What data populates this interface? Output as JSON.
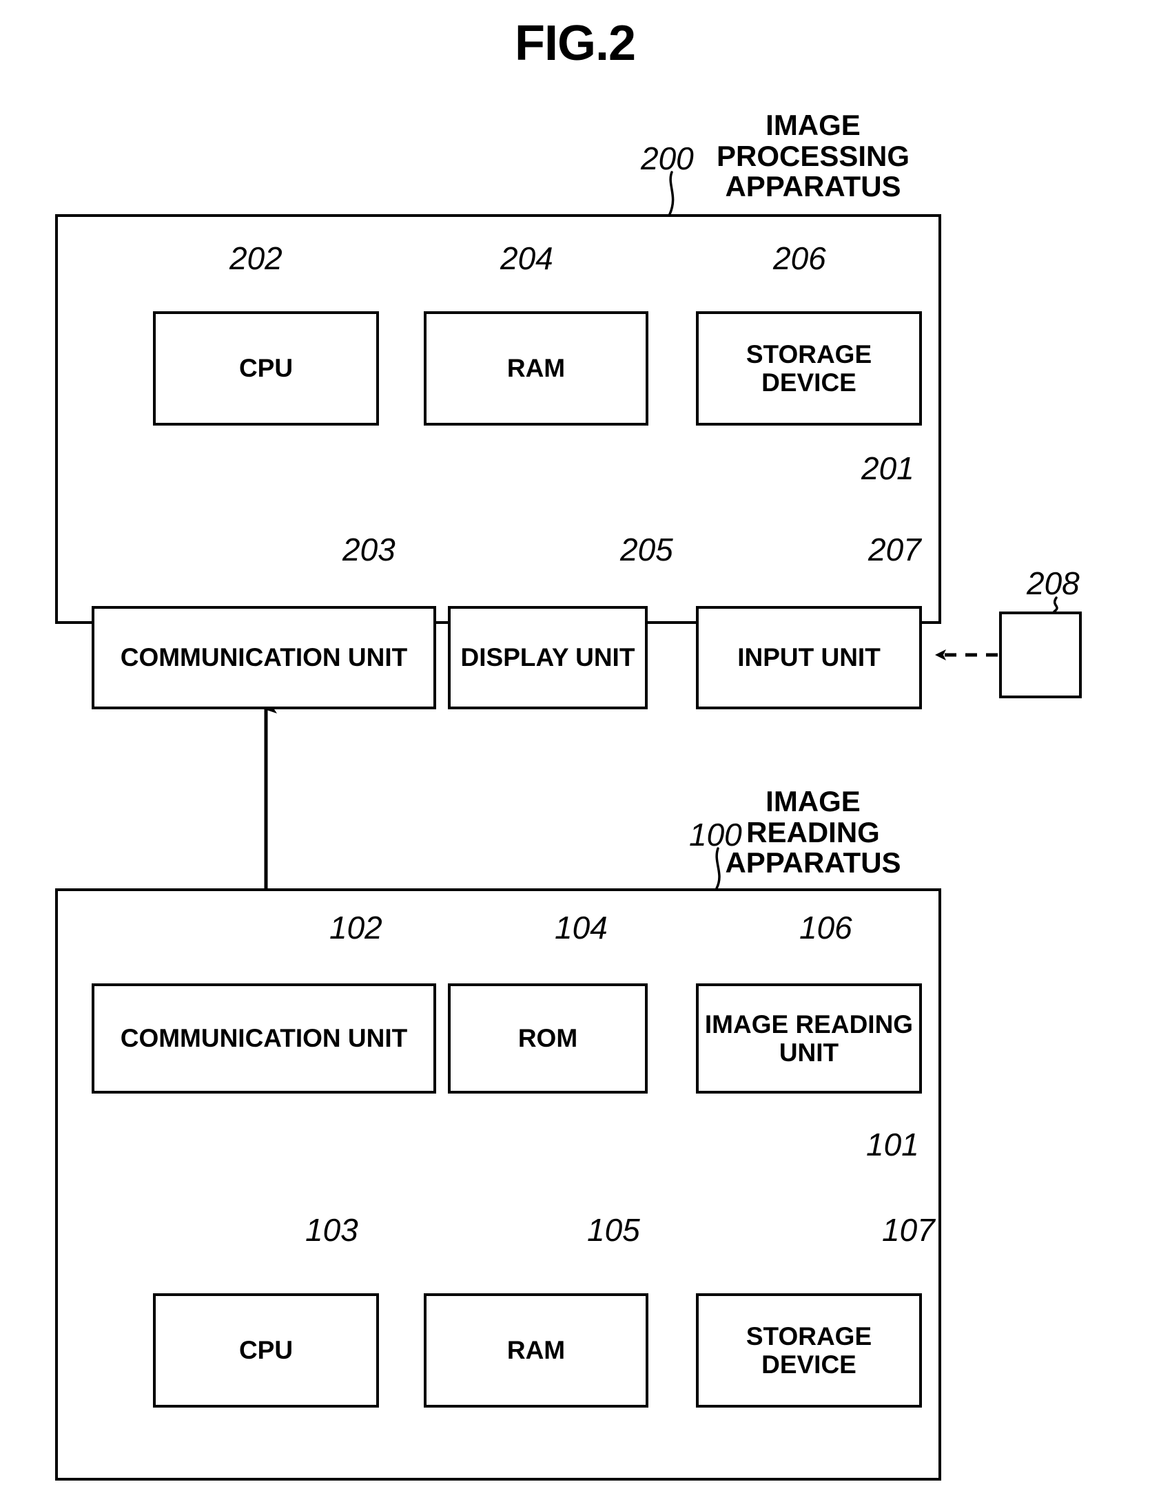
{
  "figure": {
    "title": "FIG.2",
    "type": "patent-block-diagram"
  },
  "apparatuses": [
    {
      "ref": "200",
      "caption": "IMAGE\nPROCESSING\nAPPARATUS",
      "bus": {
        "ref": "201"
      },
      "top_row": [
        {
          "ref": "202",
          "label": "CPU"
        },
        {
          "ref": "204",
          "label": "RAM"
        },
        {
          "ref": "206",
          "label": "STORAGE\nDEVICE"
        }
      ],
      "bottom_row": [
        {
          "ref": "203",
          "label": "COMMUNICATION\nUNIT"
        },
        {
          "ref": "205",
          "label": "DISPLAY\nUNIT"
        },
        {
          "ref": "207",
          "label": "INPUT\nUNIT"
        }
      ],
      "external": [
        {
          "ref": "208",
          "label": ""
        }
      ]
    },
    {
      "ref": "100",
      "caption": "IMAGE\nREADING\nAPPARATUS",
      "bus": {
        "ref": "101"
      },
      "top_row": [
        {
          "ref": "102",
          "label": "COMMUNICATION\nUNIT"
        },
        {
          "ref": "104",
          "label": "ROM"
        },
        {
          "ref": "106",
          "label": "IMAGE\nREADING\nUNIT"
        }
      ],
      "bottom_row": [
        {
          "ref": "103",
          "label": "CPU"
        },
        {
          "ref": "105",
          "label": "RAM"
        },
        {
          "ref": "107",
          "label": "STORAGE\nDEVICE"
        }
      ]
    }
  ],
  "colors": {
    "ink": "#000000",
    "paper": "#ffffff"
  }
}
